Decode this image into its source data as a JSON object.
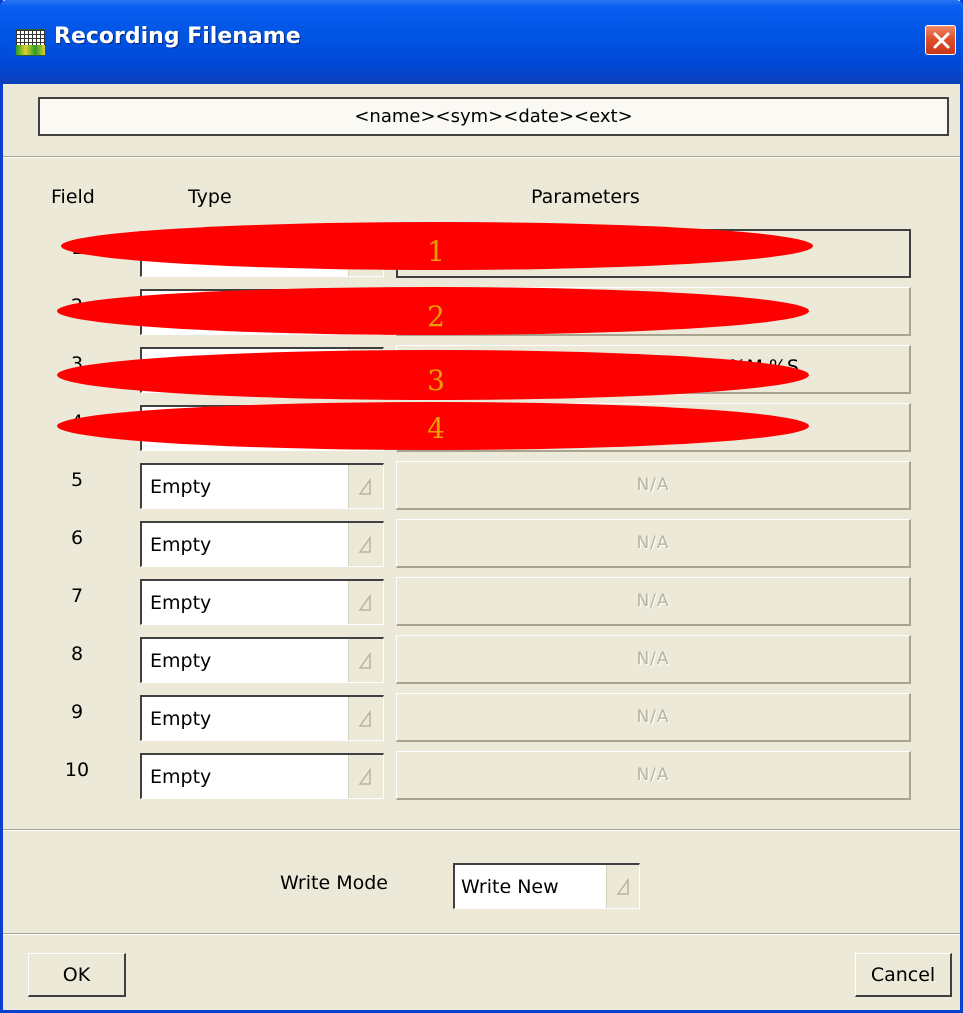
{
  "window": {
    "title": "Recording Filename"
  },
  "format": {
    "value": "<name><sym><date><ext>"
  },
  "headers": {
    "field": "Field",
    "type": "Type",
    "parameters": "Parameters"
  },
  "rows": [
    {
      "field": "1",
      "type": "",
      "parameters": ""
    },
    {
      "field": "2",
      "type": "",
      "parameters": ""
    },
    {
      "field": "3",
      "type": "",
      "parameters": "%M  %S"
    },
    {
      "field": "4",
      "type": "",
      "parameters": ""
    },
    {
      "field": "5",
      "type": "Empty",
      "parameters": "N/A"
    },
    {
      "field": "6",
      "type": "Empty",
      "parameters": "N/A"
    },
    {
      "field": "7",
      "type": "Empty",
      "parameters": "N/A"
    },
    {
      "field": "8",
      "type": "Empty",
      "parameters": "N/A"
    },
    {
      "field": "9",
      "type": "Empty",
      "parameters": "N/A"
    },
    {
      "field": "10",
      "type": "Empty",
      "parameters": "N/A"
    }
  ],
  "redactions": [
    "1",
    "2",
    "3",
    "4"
  ],
  "write_mode": {
    "label": "Write Mode",
    "value": "Write New"
  },
  "buttons": {
    "ok": "OK",
    "cancel": "Cancel"
  },
  "icons": {
    "app": "recorder-app-icon",
    "close": "close-icon",
    "dropdown": "dropdown-arrow-icon"
  },
  "colors": {
    "titlebar": "#0055E5",
    "dialog_bg": "#ECE9D8",
    "close": "#E0502C",
    "redaction": "#FF0000",
    "redaction_number": "#E8A000"
  }
}
